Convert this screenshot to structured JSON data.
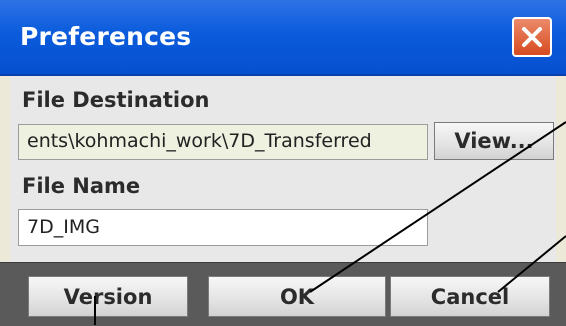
{
  "window": {
    "title": "Preferences"
  },
  "file_destination": {
    "label": "File Destination",
    "value": "ents\\kohmachi_work\\7D_Transferred",
    "view_button": "View..."
  },
  "file_name": {
    "label": "File Name",
    "value": "7D_IMG"
  },
  "footer": {
    "version_button": "Version",
    "ok_button": "OK",
    "cancel_button": "Cancel"
  },
  "icons": {
    "close": "close-icon"
  },
  "colors": {
    "titlebar": "#0a5bdc",
    "close_button": "#d64b20",
    "footer": "#5a5a5a",
    "path_field_bg": "#eef0e0"
  }
}
